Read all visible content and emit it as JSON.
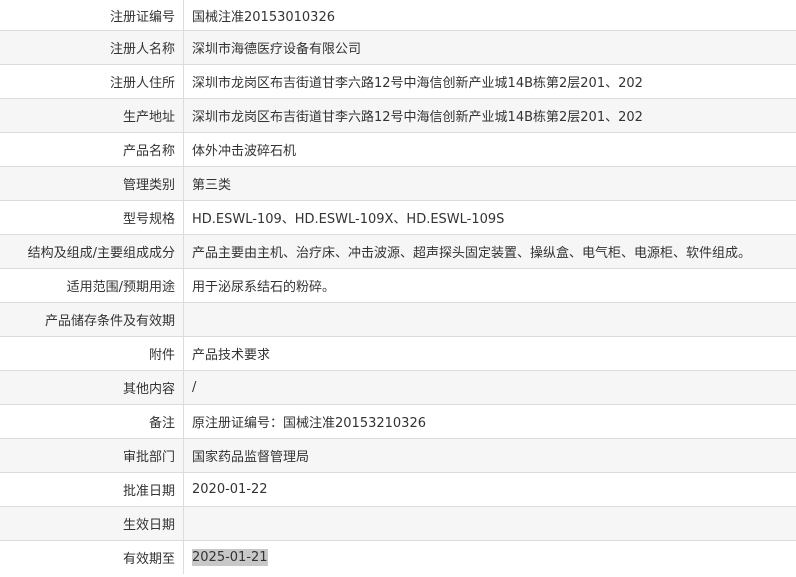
{
  "rows": [
    {
      "label": "注册证编号",
      "value": "国械注准20153010326"
    },
    {
      "label": "注册人名称",
      "value": "深圳市海德医疗设备有限公司"
    },
    {
      "label": "注册人住所",
      "value": "深圳市龙岗区布吉街道甘李六路12号中海信创新产业城14B栋第2层201、202"
    },
    {
      "label": "生产地址",
      "value": "深圳市龙岗区布吉街道甘李六路12号中海信创新产业城14B栋第2层201、202"
    },
    {
      "label": "产品名称",
      "value": "体外冲击波碎石机"
    },
    {
      "label": "管理类别",
      "value": "第三类"
    },
    {
      "label": "型号规格",
      "value": "HD.ESWL-109、HD.ESWL-109X、HD.ESWL-109S"
    },
    {
      "label": "结构及组成/主要组成成分",
      "value": "产品主要由主机、治疗床、冲击波源、超声探头固定装置、操纵盒、电气柜、电源柜、软件组成。"
    },
    {
      "label": "适用范围/预期用途",
      "value": "用于泌尿系结石的粉碎。"
    },
    {
      "label": "产品储存条件及有效期",
      "value": ""
    },
    {
      "label": "附件",
      "value": "产品技术要求"
    },
    {
      "label": "其他内容",
      "value": "/"
    },
    {
      "label": "备注",
      "value": "原注册证编号：国械注准20153210326"
    },
    {
      "label": "审批部门",
      "value": "国家药品监督管理局"
    },
    {
      "label": "批准日期",
      "value": "2020-01-22"
    },
    {
      "label": "生效日期",
      "value": ""
    },
    {
      "label": "有效期至",
      "value": "2025-01-21"
    }
  ],
  "selection": {
    "row_label": "有效期至",
    "highlight_color": "#c8c8c8"
  }
}
